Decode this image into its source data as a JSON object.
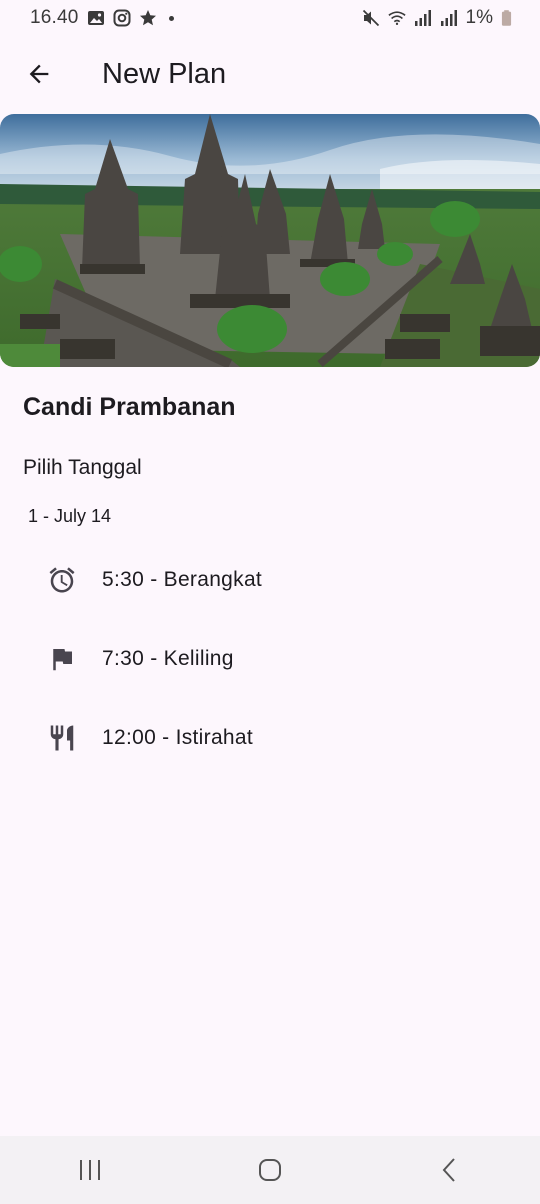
{
  "status_bar": {
    "time": "16.40",
    "battery": "1%"
  },
  "app_bar": {
    "title": "New Plan"
  },
  "place": {
    "name": "Candi Prambanan",
    "pick_date_label": "Pilih Tanggal",
    "date": "1 - July 14"
  },
  "schedule": [
    {
      "icon": "alarm-icon",
      "text": "5:30 - Berangkat"
    },
    {
      "icon": "flag-icon",
      "text": "7:30 - Keliling"
    },
    {
      "icon": "restaurant-icon",
      "text": "12:00 - Istirahat"
    }
  ],
  "colors": {
    "background": "#fdf7fd",
    "text": "#1d1b20",
    "icon": "#49454f",
    "nav_bar": "#f3f1f4"
  }
}
